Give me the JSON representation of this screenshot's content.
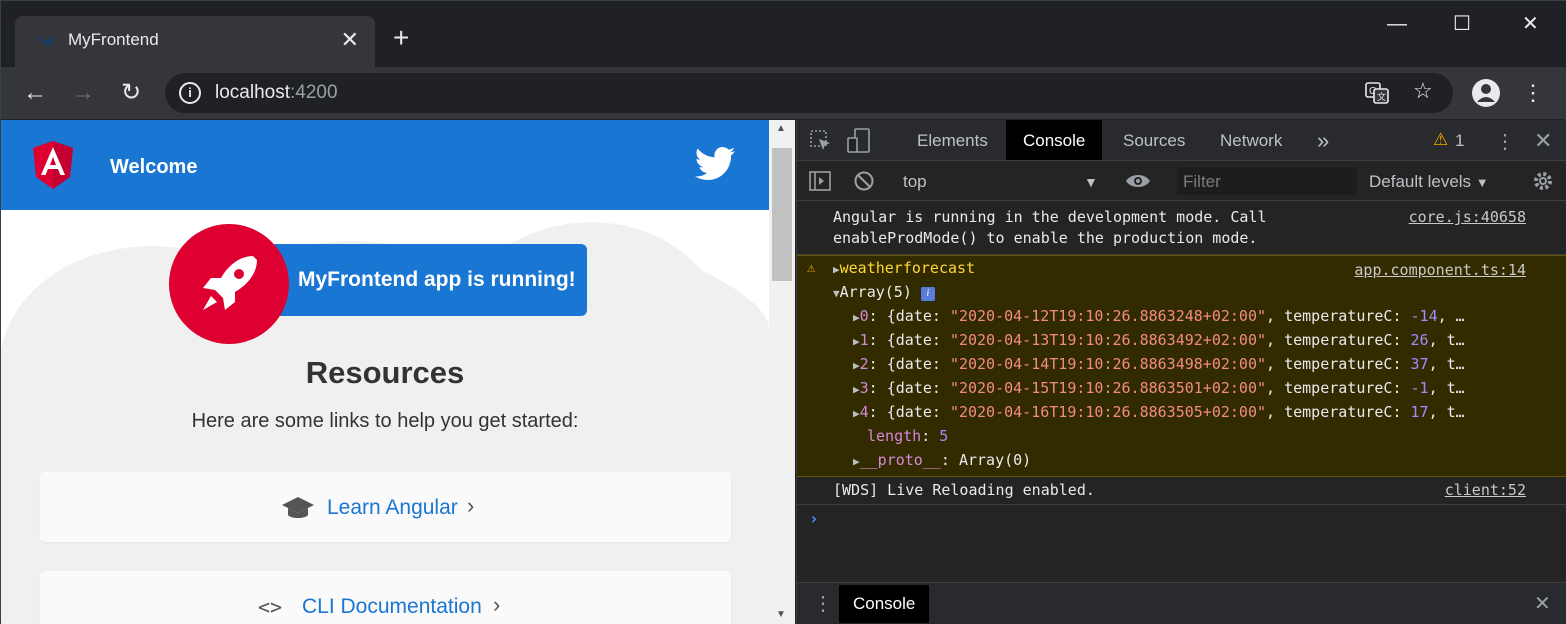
{
  "browser": {
    "tab_title": "MyFrontend",
    "tab_close": "✕",
    "new_tab": "+",
    "window_controls": {
      "minimize": "—",
      "maximize": "☐",
      "close": "✕"
    },
    "url_host": "localhost",
    "url_port": ":4200"
  },
  "page": {
    "header_title": "Welcome",
    "running_text": "MyFrontend app is running!",
    "resources_title": "Resources",
    "resources_subtitle": "Here are some links to help you get started:",
    "links": [
      {
        "label": "Learn Angular",
        "icon": "graduation-cap-icon",
        "icon_glyph": "🎓"
      },
      {
        "label": "CLI Documentation",
        "icon": "code-brackets-icon",
        "icon_glyph": "<>"
      }
    ],
    "brand_color": "#1976d2",
    "angular_red": "#dd0031"
  },
  "devtools": {
    "tabs": [
      "Elements",
      "Console",
      "Sources",
      "Network"
    ],
    "more_tabs": "»",
    "warning_count": "1",
    "context": "top",
    "filter_placeholder": "Filter",
    "levels": "Default levels",
    "messages": {
      "dev_mode_line1": "Angular is running in the development mode. Call",
      "dev_mode_line2": "enableProdMode() to enable the production mode.",
      "dev_mode_source": "core.js:40658",
      "warn_label": "weatherforecast",
      "warn_source": "app.component.ts:14",
      "array_label": "Array(5)",
      "items": [
        {
          "index": "0",
          "date": "\"2020-04-12T19:10:26.8863248+02:00\"",
          "temp": "-14",
          "tail": ", …"
        },
        {
          "index": "1",
          "date": "\"2020-04-13T19:10:26.8863492+02:00\"",
          "temp": "26",
          "tail": ", t…"
        },
        {
          "index": "2",
          "date": "\"2020-04-14T19:10:26.8863498+02:00\"",
          "temp": "37",
          "tail": ", t…"
        },
        {
          "index": "3",
          "date": "\"2020-04-15T19:10:26.8863501+02:00\"",
          "temp": "-1",
          "tail": ", t…"
        },
        {
          "index": "4",
          "date": "\"2020-04-16T19:10:26.8863505+02:00\"",
          "temp": "17",
          "tail": ", t…"
        }
      ],
      "length_key": "length",
      "length_value": "5",
      "proto_key": "__proto__",
      "proto_value": "Array(0)",
      "wds_text": "[WDS] Live Reloading enabled.",
      "wds_source": "client:52"
    },
    "drawer_tab": "Console"
  }
}
